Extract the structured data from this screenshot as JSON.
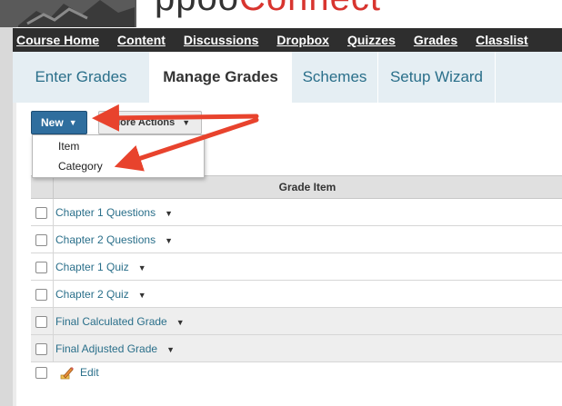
{
  "logo": {
    "text_dark": "ppoo",
    "text_red": "Connect"
  },
  "course_nav": {
    "items": [
      {
        "label": "Course Home"
      },
      {
        "label": "Content"
      },
      {
        "label": "Discussions"
      },
      {
        "label": "Dropbox"
      },
      {
        "label": "Quizzes"
      },
      {
        "label": "Grades"
      },
      {
        "label": "Classlist"
      }
    ]
  },
  "tabs": [
    {
      "label": "Enter Grades",
      "active": false
    },
    {
      "label": "Manage Grades",
      "active": true
    },
    {
      "label": "Schemes",
      "active": false
    },
    {
      "label": "Setup Wizard",
      "active": false
    }
  ],
  "toolbar": {
    "new_label": "New",
    "more_actions_label": "More Actions"
  },
  "new_menu": {
    "items": [
      {
        "label": "Item"
      },
      {
        "label": "Category"
      }
    ]
  },
  "table": {
    "header": "Grade Item",
    "rows": [
      {
        "label": "Chapter 1 Questions",
        "calculated": false
      },
      {
        "label": "Chapter 2 Questions",
        "calculated": false
      },
      {
        "label": "Chapter 1 Quiz",
        "calculated": false
      },
      {
        "label": "Chapter 2 Quiz",
        "calculated": false
      },
      {
        "label": "Final Calculated Grade",
        "calculated": true
      },
      {
        "label": "Final Adjusted Grade",
        "calculated": true
      }
    ]
  },
  "footer": {
    "edit_label": "Edit"
  },
  "colors": {
    "link": "#2a6f8a",
    "nav_bar": "#2e2e2e",
    "new_button": "#2f6e9e",
    "annotation_arrow": "#e8432d"
  },
  "icons": {
    "caret": "caret-down-icon",
    "edit": "pencil-icon",
    "checkbox": "checkbox-icon"
  }
}
